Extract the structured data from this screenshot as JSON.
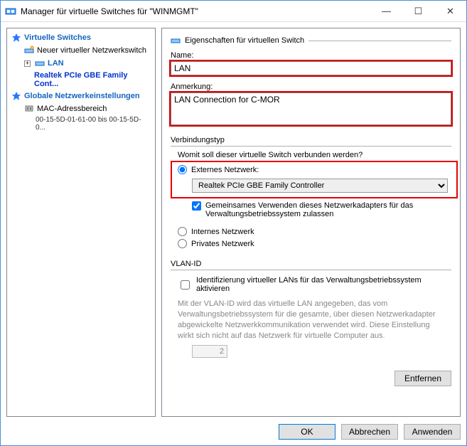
{
  "window": {
    "title": "Manager für virtuelle Switches für \"WINMGMT\""
  },
  "tree": {
    "header1": "Virtuelle Switches",
    "new_switch": "Neuer virtueller Netzwerkswitch",
    "lan": "LAN",
    "lan_nic": "Realtek PCIe GBE Family Cont...",
    "header2": "Globale Netzwerkeinstellungen",
    "mac_range_label": "MAC-Adressbereich",
    "mac_range_value": "00-15-5D-01-61-00 bis 00-15-5D-0..."
  },
  "panel": {
    "header": "Eigenschaften für virtuellen Switch",
    "name_label": "Name:",
    "name_value": "LAN",
    "note_label": "Anmerkung:",
    "note_value": "LAN Connection for C-MOR",
    "conn_type_title": "Verbindungstyp",
    "conn_type_prompt": "Womit soll dieser virtuelle Switch verbunden werden?",
    "radio_external": "Externes Netzwerk:",
    "nic_selected": "Realtek PCIe GBE Family Controller",
    "share_check": "Gemeinsames Verwenden dieses Netzwerkadapters für das Verwaltungsbetriebssystem zulassen",
    "radio_internal": "Internes Netzwerk",
    "radio_private": "Privates Netzwerk",
    "vlan_title": "VLAN-ID",
    "vlan_check": "Identifizierung virtueller LANs für das Verwaltungsbetriebssystem aktivieren",
    "vlan_desc": "Mit der VLAN-ID wird das virtuelle LAN angegeben, das vom Verwaltungsbetriebssystem für die gesamte, über diesen Netzwerkadapter abgewickelte Netzwerkkommunikation verwendet wird. Diese Einstellung wirkt sich nicht auf das Netzwerk für virtuelle Computer aus.",
    "vlan_value": "2",
    "remove_btn": "Entfernen"
  },
  "footer": {
    "ok": "OK",
    "cancel": "Abbrechen",
    "apply": "Anwenden"
  }
}
